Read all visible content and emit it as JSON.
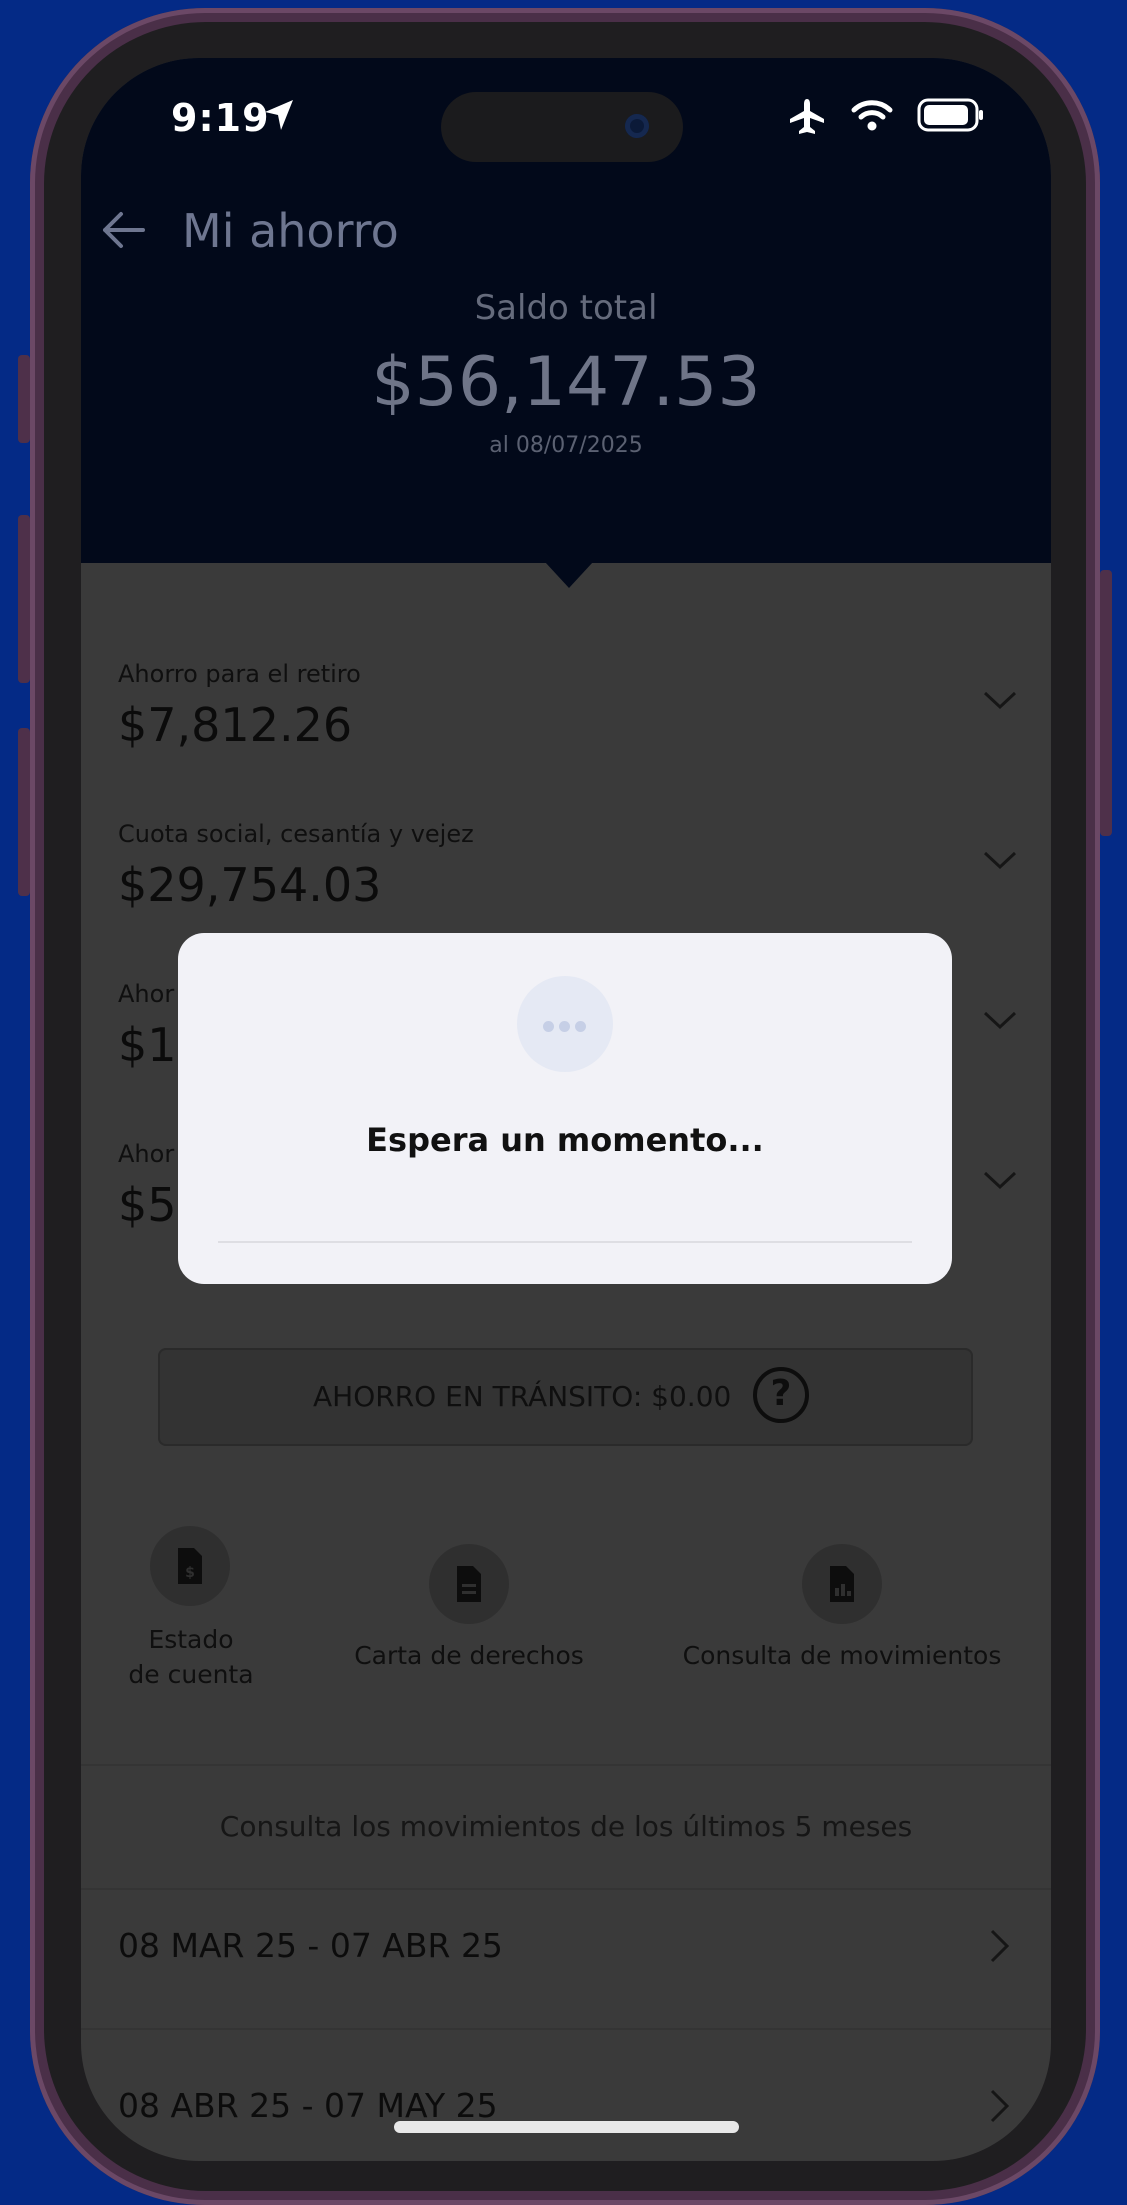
{
  "status_bar": {
    "time": "9:19",
    "location_icon": "location-arrow-icon",
    "icons": [
      "airplane-icon",
      "wifi-icon",
      "battery-icon"
    ]
  },
  "header": {
    "title": "Mi ahorro",
    "back_icon": "back-arrow-icon",
    "saldo_label": "Saldo total",
    "saldo_amount": "$56,147.53",
    "saldo_date": "al 08/07/2025"
  },
  "accounts": [
    {
      "label": "Ahorro para el retiro",
      "amount": "$7,812.26"
    },
    {
      "label": "Cuota social, cesantía y vejez",
      "amount": "$29,754.03"
    },
    {
      "label": "Ahor",
      "amount": "$1"
    },
    {
      "label": "Ahor",
      "amount": "$5"
    }
  ],
  "transit": {
    "text": "AHORRO EN TRÁNSITO: $0.00",
    "help": "?"
  },
  "shortcuts": [
    {
      "label_line1": "Estado",
      "label_line2": "de cuenta",
      "icon": "statement-doc-icon"
    },
    {
      "label": "Carta de derechos",
      "icon": "document-icon"
    },
    {
      "label": "Consulta de movimientos",
      "icon": "document-chart-icon"
    }
  ],
  "movements": {
    "title": "Consulta los movimientos de los últimos 5 meses",
    "periods": [
      "08 MAR 25 - 07 ABR 25",
      "08 ABR 25 - 07 MAY 25"
    ]
  },
  "dialog": {
    "message": "Espera un momento..."
  },
  "colors": {
    "background": "#042a86",
    "header": "#02091a",
    "overlay_content": "#3a3a3a",
    "dialog": "#f2f2f7"
  }
}
